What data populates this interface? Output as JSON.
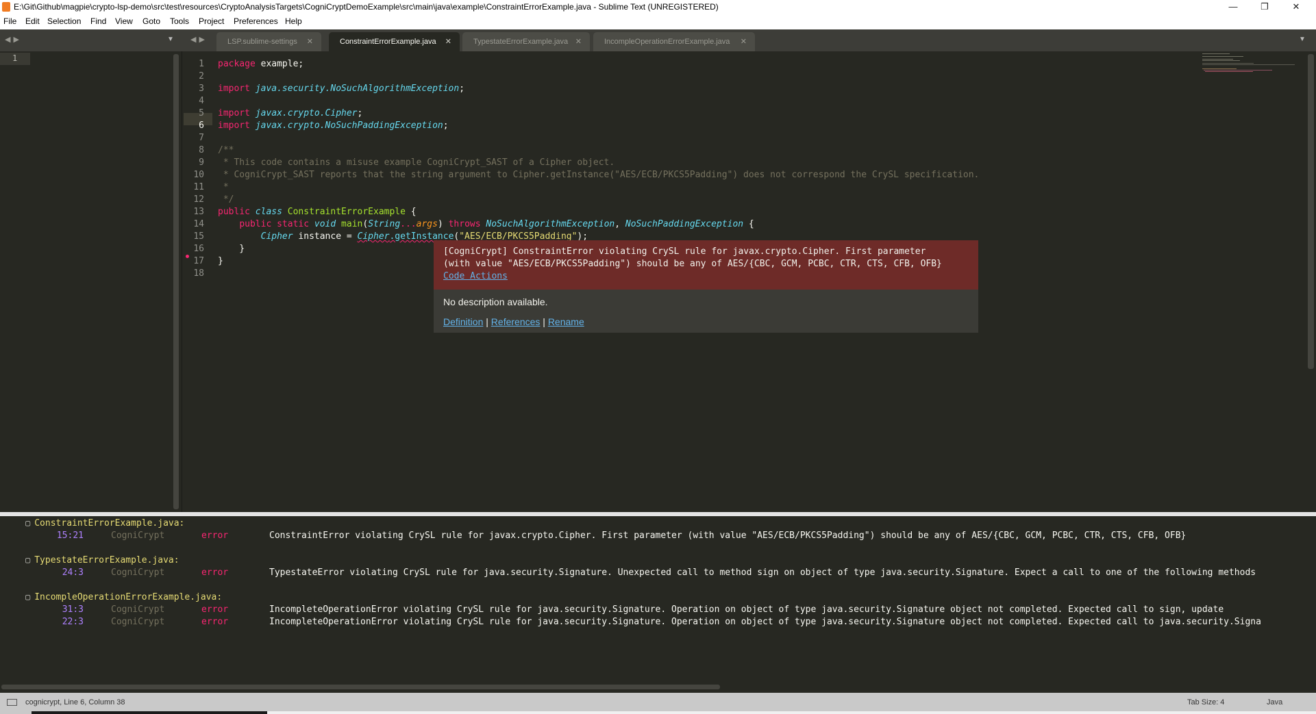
{
  "window": {
    "title": "E:\\Git\\Github\\magpie\\crypto-lsp-demo\\src\\test\\resources\\CryptoAnalysisTargets\\CogniCryptDemoExample\\src\\main\\java\\example\\ConstraintErrorExample.java - Sublime Text (UNREGISTERED)",
    "minimize": "—",
    "restore": "❐",
    "close": "✕"
  },
  "menu": [
    "File",
    "Edit",
    "Selection",
    "Find",
    "View",
    "Goto",
    "Tools",
    "Project",
    "Preferences",
    "Help"
  ],
  "tabs": [
    {
      "label": "LSP.sublime-settings",
      "active": false
    },
    {
      "label": "ConstraintErrorExample.java",
      "active": true
    },
    {
      "label": "TypestateErrorExample.java",
      "active": false
    },
    {
      "label": "IncompleOperationErrorExample.java",
      "active": false
    }
  ],
  "tab_close_glyph": "✕",
  "left_pane": {
    "line_number": "1"
  },
  "editor": {
    "line_numbers": [
      "1",
      "2",
      "3",
      "4",
      "5",
      "6",
      "7",
      "8",
      "9",
      "10",
      "11",
      "12",
      "13",
      "14",
      "15",
      "16",
      "17",
      "18"
    ],
    "lines": {
      "l1": {
        "kw": "package",
        "rest": " example;"
      },
      "l3": {
        "kw": "import",
        "pkg": " java.security.",
        "cls": "NoSuchAlgorithmException",
        "end": ";"
      },
      "l5": {
        "kw": "import",
        "pkg": " javax.crypto.",
        "cls": "Cipher",
        "end": ";"
      },
      "l6": {
        "kw": "import",
        "pkg": " javax.crypto.",
        "cls": "NoSuchPaddingException",
        "end": ";"
      },
      "l8": "/**",
      "l9": " * This code contains a misuse example CogniCrypt_SAST of a Cipher object.",
      "l10": " * CogniCrypt_SAST reports that the string argument to Cipher.getInstance(\"AES/ECB/PKCS5Padding\") does not correspond the CrySL specification.",
      "l11": " *",
      "l12": " */",
      "l13": {
        "kw1": "public",
        "kw2": "class",
        "name": "ConstraintErrorExample",
        "end": " {"
      },
      "l14": {
        "kw1": "public",
        "kw2": "static",
        "ty": "void",
        "fn": "main",
        "p1": "String",
        "dots": "...",
        "arg": "args",
        "throws": "throws",
        "e1": "NoSuchAlgorithmException",
        "e2": "NoSuchPaddingException",
        "end": " {"
      },
      "l15": {
        "ty": "Cipher",
        "var": " instance = ",
        "cls": "Cipher",
        "call": ".getInstance",
        "str": "\"AES/ECB/PKCS5Padding\"",
        "end": ");"
      },
      "l16": "    }",
      "l17": "}"
    }
  },
  "hover": {
    "error_line1": "[CogniCrypt] ConstraintError violating CrySL rule for javax.crypto.Cipher. First parameter",
    "error_line2": "(with value \"AES/ECB/PKCS5Padding\") should be any of AES/{CBC, GCM, PCBC, CTR, CTS, CFB, OFB}",
    "code_actions": "Code Actions",
    "no_description": "No description available.",
    "links": [
      "Definition",
      "References",
      "Rename"
    ],
    "separator": "|"
  },
  "diagnostics": {
    "fold_glyph": "▢",
    "files": [
      {
        "name": "ConstraintErrorExample.java:",
        "items": [
          {
            "pos": "15:21",
            "source": "CogniCrypt",
            "severity": "error",
            "message": "ConstraintError violating CrySL rule for javax.crypto.Cipher. First parameter (with value \"AES/ECB/PKCS5Padding\") should be any of AES/{CBC, GCM, PCBC, CTR, CTS, CFB, OFB}"
          }
        ]
      },
      {
        "name": "TypestateErrorExample.java:",
        "items": [
          {
            "pos": "24:3",
            "source": "CogniCrypt",
            "severity": "error",
            "message": "TypestateError violating CrySL rule for java.security.Signature. Unexpected call to method sign on object of type java.security.Signature. Expect a call to one of the following methods"
          }
        ]
      },
      {
        "name": "IncompleOperationErrorExample.java:",
        "items": [
          {
            "pos": "31:3",
            "source": "CogniCrypt",
            "severity": "error",
            "message": "IncompleteOperationError violating CrySL rule for java.security.Signature. Operation on object of type java.security.Signature object not completed. Expected call to sign, update"
          },
          {
            "pos": "22:3",
            "source": "CogniCrypt",
            "severity": "error",
            "message": "IncompleteOperationError violating CrySL rule for java.security.Signature. Operation on object of type java.security.Signature object not completed. Expected call to java.security.Signa"
          }
        ]
      }
    ]
  },
  "status": {
    "text": "cognicrypt, Line 6, Column 38",
    "tab_size": "Tab Size: 4",
    "syntax": "Java"
  }
}
